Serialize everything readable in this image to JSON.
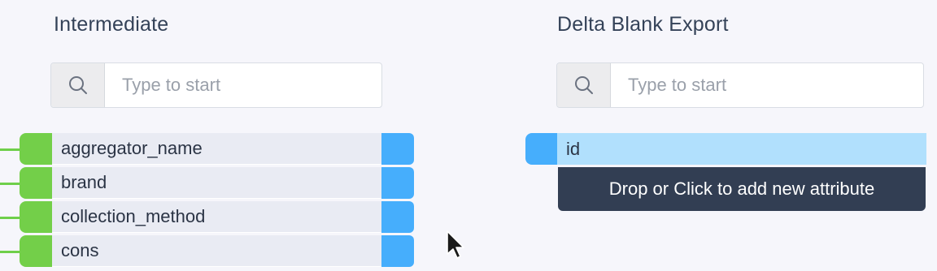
{
  "left_panel": {
    "title": "Intermediate",
    "search": {
      "placeholder": "Type to start",
      "value": ""
    },
    "attributes": [
      {
        "label": "aggregator_name"
      },
      {
        "label": "brand"
      },
      {
        "label": "collection_method"
      },
      {
        "label": "cons"
      }
    ]
  },
  "right_panel": {
    "title": "Delta Blank Export",
    "search": {
      "placeholder": "Type to start",
      "value": ""
    },
    "attributes": [
      {
        "label": "id"
      }
    ],
    "drop_zone_label": "Drop or Click to add new attribute"
  },
  "icons": {
    "search": "magnifier-icon",
    "cursor": "mouse-pointer-icon"
  },
  "colors": {
    "background": "#f6f6fb",
    "source_handle": "#73cf49",
    "target_handle": "#46aefc",
    "row_background": "#e9ebf3",
    "selected_row": "#b1e0fd",
    "drop_zone": "#323e53"
  }
}
